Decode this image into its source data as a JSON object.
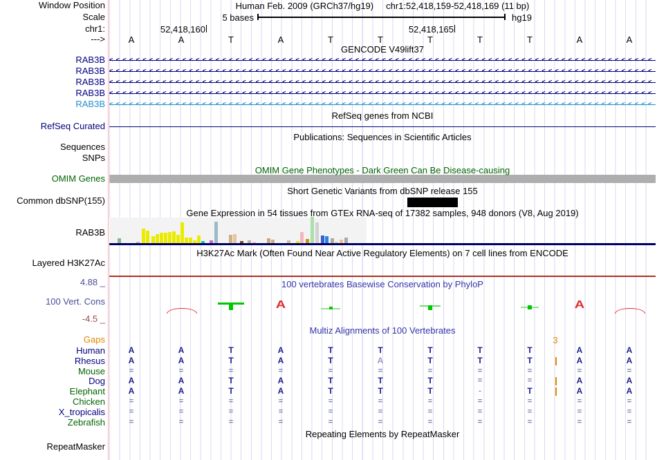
{
  "header": {
    "window_position_label": "Window Position",
    "assembly": "Human Feb. 2009 (GRCh37/hg19)",
    "position": "chr1:52,418,159-52,418,169 (11 bp)",
    "scale_label": "Scale",
    "scale_value": "5 bases",
    "genome": "hg19",
    "chrom_label": "chr1:",
    "strand_arrow": "--->",
    "coordinate_ticks": [
      {
        "text": "52,418,160"
      },
      {
        "text": "52,418,165"
      }
    ]
  },
  "sequence": {
    "bases": [
      "A",
      "A",
      "T",
      "A",
      "T",
      "T",
      "T",
      "T",
      "T",
      "A",
      "A"
    ]
  },
  "tracks": {
    "gencode": {
      "title": "GENCODE V49lift37",
      "genes": [
        {
          "label": "RAB3B",
          "color": "#000080"
        },
        {
          "label": "RAB3B",
          "color": "#000080"
        },
        {
          "label": "RAB3B",
          "color": "#000080"
        },
        {
          "label": "RAB3B",
          "color": "#000080"
        },
        {
          "label": "RAB3B",
          "color": "#1f8fce"
        }
      ]
    },
    "refseq": {
      "title": "RefSeq genes from NCBI",
      "label": "RefSeq Curated",
      "line_color": "#000080"
    },
    "publications": {
      "title": "Publications: Sequences in Scientific Articles",
      "rows": [
        "Sequences",
        "SNPs"
      ]
    },
    "omim": {
      "title": "OMIM Gene Phenotypes - Dark Green Can Be Disease-causing",
      "label": "OMIM Genes",
      "title_color": "#006400",
      "bar_color": "#aeaeae"
    },
    "dbsnp": {
      "title": "Short Genetic Variants from dbSNP release 155",
      "label": "Common dbSNP(155)",
      "variant_color": "#000000"
    },
    "gtex": {
      "title": "Gene Expression in 54 tissues from GTEx RNA-seq of 17382 samples, 948 donors (V8, Aug 2019)",
      "label": "RAB3B"
    },
    "h3k27ac": {
      "title": "H3K27Ac Mark (Often Found Near Active Regulatory Elements) on 7 cell lines from ENCODE",
      "label": "Layered H3K27Ac",
      "line_color": "#a83020"
    },
    "conservation": {
      "title": "100 vertebrates Basewise Conservation by PhyloP",
      "label": "100 Vert. Cons",
      "max": "4.88 _",
      "min": "-4.5 _",
      "pos_color": "#00c800",
      "neg_color": "#e03030",
      "glyphs": [
        {
          "col": 1,
          "type": "neg_arc"
        },
        {
          "col": 2,
          "type": "pos_T"
        },
        {
          "col": 3,
          "type": "pos_A"
        },
        {
          "col": 4,
          "type": "pos_dash"
        },
        {
          "col": 6,
          "type": "pos_T_small"
        },
        {
          "col": 8,
          "type": "pos_square"
        },
        {
          "col": 9,
          "type": "pos_A"
        },
        {
          "col": 10,
          "type": "neg_arc"
        }
      ]
    },
    "multiz": {
      "title": "Multiz Alignments of 100 Vertebrates",
      "gaps_label": "Gaps",
      "gap_count": "3",
      "species": [
        {
          "name": "Human",
          "color": "#000080",
          "insert": false,
          "symbols": [
            "A",
            "A",
            "T",
            "A",
            "T",
            "T",
            "T",
            "T",
            "T",
            "A",
            "A"
          ]
        },
        {
          "name": "Rhesus",
          "color": "#000080",
          "insert": true,
          "symbols": [
            "A",
            "A",
            "T",
            "A",
            "T",
            "~A",
            "T",
            "T",
            "T",
            "A",
            "A"
          ]
        },
        {
          "name": "Mouse",
          "color": "#006400",
          "insert": false,
          "symbols": [
            "=",
            "=",
            "=",
            "=",
            "=",
            "=",
            "=",
            "=",
            "=",
            "=",
            "="
          ]
        },
        {
          "name": "Dog",
          "color": "#000080",
          "insert": true,
          "symbols": [
            "A",
            "A",
            "T",
            "A",
            "T",
            "T",
            "T",
            "=",
            "=",
            "A",
            "A"
          ]
        },
        {
          "name": "Elephant",
          "color": "#006400",
          "insert": true,
          "symbols": [
            "A",
            "A",
            "T",
            "A",
            "T",
            "T",
            "T",
            "-",
            "T",
            "A",
            "A"
          ]
        },
        {
          "name": "Chicken",
          "color": "#006400",
          "insert": false,
          "symbols": [
            "=",
            "=",
            "=",
            "=",
            "=",
            "=",
            "=",
            "=",
            "=",
            "=",
            "="
          ]
        },
        {
          "name": "X_tropicalis",
          "color": "#000080",
          "insert": false,
          "symbols": [
            "=",
            "=",
            "=",
            "=",
            "=",
            "=",
            "=",
            "=",
            "=",
            "=",
            "="
          ]
        },
        {
          "name": "Zebrafish",
          "color": "#006400",
          "insert": false,
          "symbols": [
            "=",
            "=",
            "=",
            "=",
            "=",
            "=",
            "=",
            "=",
            "=",
            "=",
            "="
          ]
        }
      ]
    },
    "repeatmasker": {
      "title": "Repeating Elements by RepeatMasker",
      "label": "RepeatMasker"
    }
  },
  "chart_data": {
    "type": "bar",
    "title": "Gene Expression in 54 tissues from GTEx RNA-seq of 17382 samples, 948 donors (V8, Aug 2019)",
    "gene": "RAB3B",
    "bars": [
      [
        12,
        7,
        "#8cb48c"
      ],
      [
        39,
        2,
        "#c9b8a8"
      ],
      [
        47,
        21,
        "#ebeb00"
      ],
      [
        53,
        18,
        "#ebeb00"
      ],
      [
        61,
        10,
        "#ebeb00"
      ],
      [
        67,
        13,
        "#ebeb00"
      ],
      [
        73,
        15,
        "#ebeb00"
      ],
      [
        79,
        15,
        "#ebeb00"
      ],
      [
        85,
        16,
        "#ebeb00"
      ],
      [
        91,
        17,
        "#ebeb00"
      ],
      [
        97,
        12,
        "#ebeb00"
      ],
      [
        103,
        30,
        "#ebeb00"
      ],
      [
        109,
        8,
        "#ebeb00"
      ],
      [
        115,
        8,
        "#ebeb00"
      ],
      [
        121,
        4,
        "#ebeb00"
      ],
      [
        127,
        11,
        "#ebeb00"
      ],
      [
        133,
        3,
        "#00c8c8"
      ],
      [
        145,
        4,
        "#c864c8"
      ],
      [
        152,
        31,
        "#9db9cb"
      ],
      [
        173,
        12,
        "#cdb285"
      ],
      [
        179,
        13,
        "#e6c49c"
      ],
      [
        189,
        3,
        "#7a4a14"
      ],
      [
        200,
        4,
        "#bfae96"
      ],
      [
        207,
        2,
        "#f2c6cc"
      ],
      [
        228,
        7,
        "#c8a878"
      ],
      [
        234,
        5,
        "#cbae84"
      ],
      [
        257,
        4,
        "#d2ba98"
      ],
      [
        270,
        3,
        "#e6e600"
      ],
      [
        276,
        16,
        "#f4b6c2"
      ],
      [
        284,
        6,
        "#c89610"
      ],
      [
        291,
        38,
        "#abdfab"
      ],
      [
        298,
        30,
        "#d2d2d2"
      ],
      [
        306,
        11,
        "#3a5ecd"
      ],
      [
        312,
        10,
        "#2287e8"
      ],
      [
        320,
        7,
        "#b5a896"
      ],
      [
        326,
        2,
        "#d8d0c4"
      ],
      [
        333,
        5,
        "#f0c084"
      ],
      [
        340,
        8,
        "#a8a8a8"
      ]
    ]
  }
}
